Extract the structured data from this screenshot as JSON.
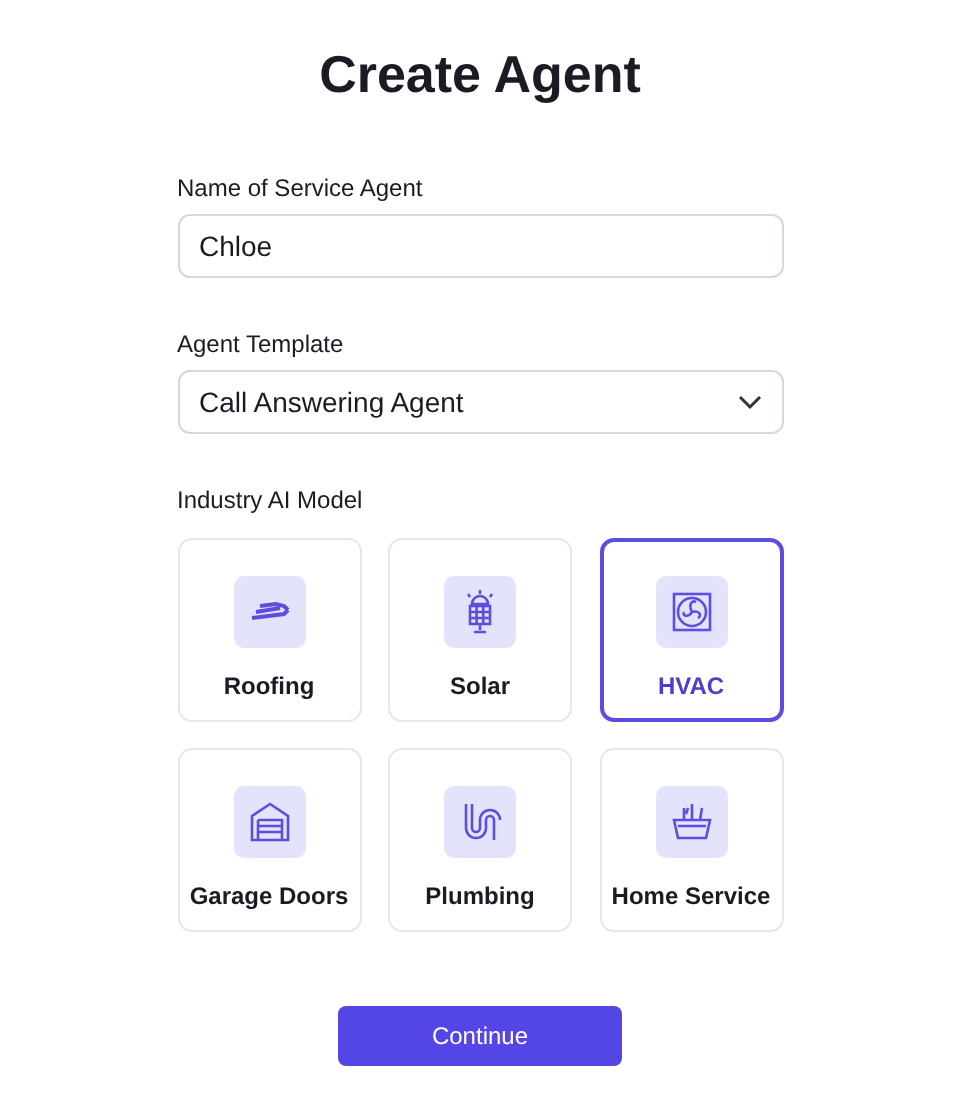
{
  "title": "Create Agent",
  "name_field": {
    "label": "Name of Service Agent",
    "value": "Chloe"
  },
  "template_field": {
    "label": "Agent Template",
    "value": "Call Answering Agent"
  },
  "models_label": "Industry AI Model",
  "models": [
    {
      "label": "Roofing",
      "kind": "roofing",
      "selected": false
    },
    {
      "label": "Solar",
      "kind": "solar",
      "selected": false
    },
    {
      "label": "HVAC",
      "kind": "hvac",
      "selected": true
    },
    {
      "label": "Garage Doors",
      "kind": "garage",
      "selected": false
    },
    {
      "label": "Plumbing",
      "kind": "plumbing",
      "selected": false
    },
    {
      "label": "Home Service",
      "kind": "home",
      "selected": false
    }
  ],
  "continue_button": "Continue"
}
